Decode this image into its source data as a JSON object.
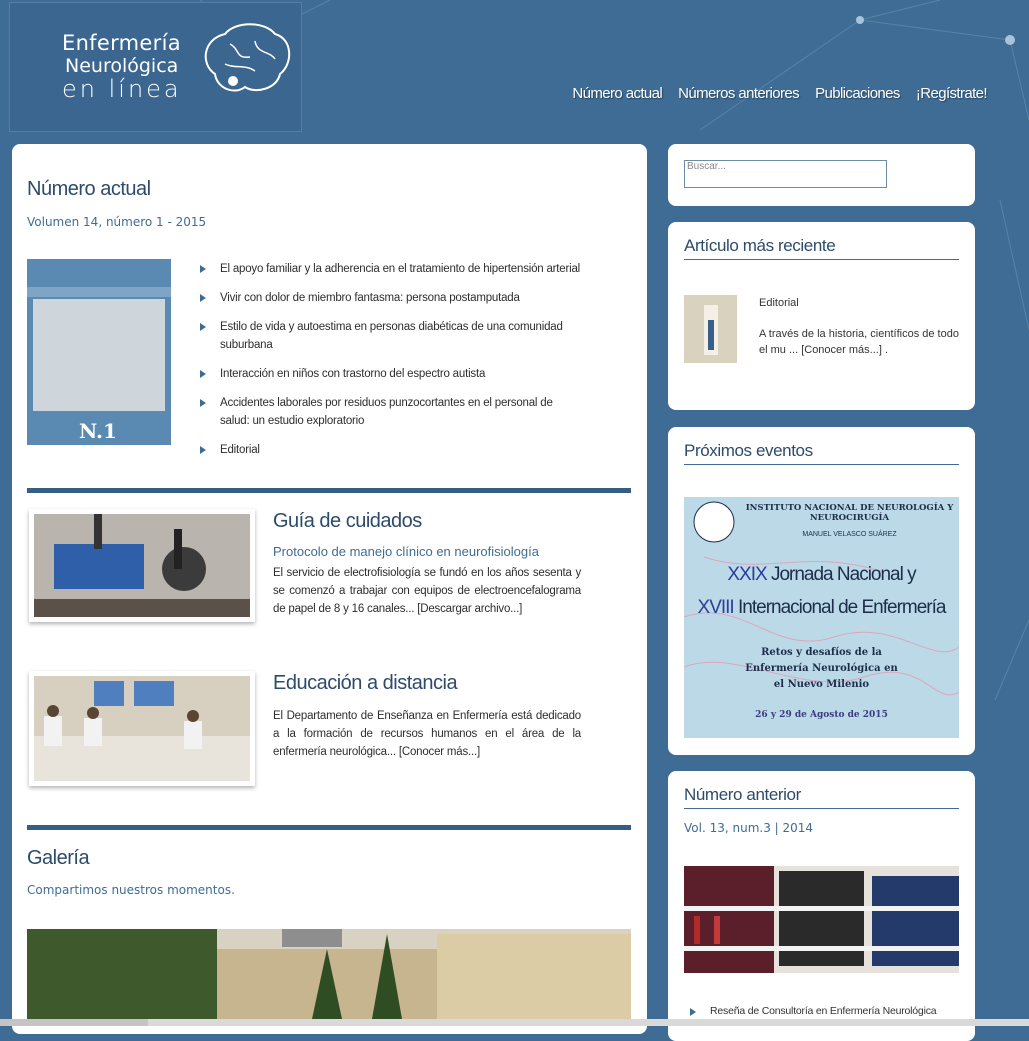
{
  "logo": {
    "line1": "Enfermería",
    "line2": "Neurológica",
    "line3": "en línea"
  },
  "nav": {
    "items": [
      "Número actual",
      "Números anteriores",
      "Publicaciones",
      "¡Regístrate!"
    ]
  },
  "current_issue": {
    "title": "Número actual",
    "subtitle": "Volumen 14, número 1 - 2015",
    "cover_number": "N.1",
    "articles": [
      "El apoyo familiar y la adherencia en el tratamiento de hipertensión arterial",
      "Vivir con dolor de miembro fantasma: persona postamputada",
      "Estilo de vida y autoestima en personas diabéticas de una comunidad suburbana",
      "Interacción en niños con trastorno del espectro autista",
      "Accidentes laborales por residuos punzocortantes en el personal de salud: un estudio exploratorio",
      "Editorial"
    ]
  },
  "guide": {
    "title": "Guía de cuidados",
    "subtitle": "Protocolo de manejo clínico en neurofisiología",
    "text": "El servicio de electrofisiología se fundó en los años sesenta y se comenzó a trabajar con equipos de electroencefalograma de papel de 8 y 16 canales...",
    "link": "[Descargar archivo...]"
  },
  "distance": {
    "title": "Educación a distancia",
    "text": "El Departamento de Enseñanza en Enfermería está dedicado a la formación de recursos humanos en el área de la enfermería neurológica...",
    "link": "[Conocer más...]"
  },
  "gallery": {
    "title": "Galería",
    "subtitle": "Compartimos nuestros momentos."
  },
  "search": {
    "placeholder": "Buscar..."
  },
  "recent": {
    "title": "Artículo más reciente",
    "item_title": "Editorial",
    "item_text": "A través de la historia, científicos de todo el mu ...",
    "link": "[Conocer más...]",
    "tail": "."
  },
  "events": {
    "title": "Próximos eventos",
    "org_line1": "INSTITUTO NACIONAL DE NEUROLOGÍA Y NEUROCIRUGÍA",
    "org_line2": "MANUEL VELASCO SUÁREZ",
    "line1_num": "XXIX",
    "line1_text": " Jornada Nacional y",
    "line2_num": "XVIII",
    "line2_text": " Internacional de Enfermería",
    "line3": "Retos y desafíos de la Enfermería Neurológica en el Nuevo Milenio",
    "line4": "26 y 29 de Agosto de 2015"
  },
  "previous": {
    "title": "Número anterior",
    "subtitle": "Vol. 13, num.3 | 2014",
    "item": "Reseña de Consultoría en Enfermería Neurológica"
  },
  "colors": {
    "background": "#3f6c94",
    "accent": "#355e86",
    "heading": "#2d4b6a"
  }
}
